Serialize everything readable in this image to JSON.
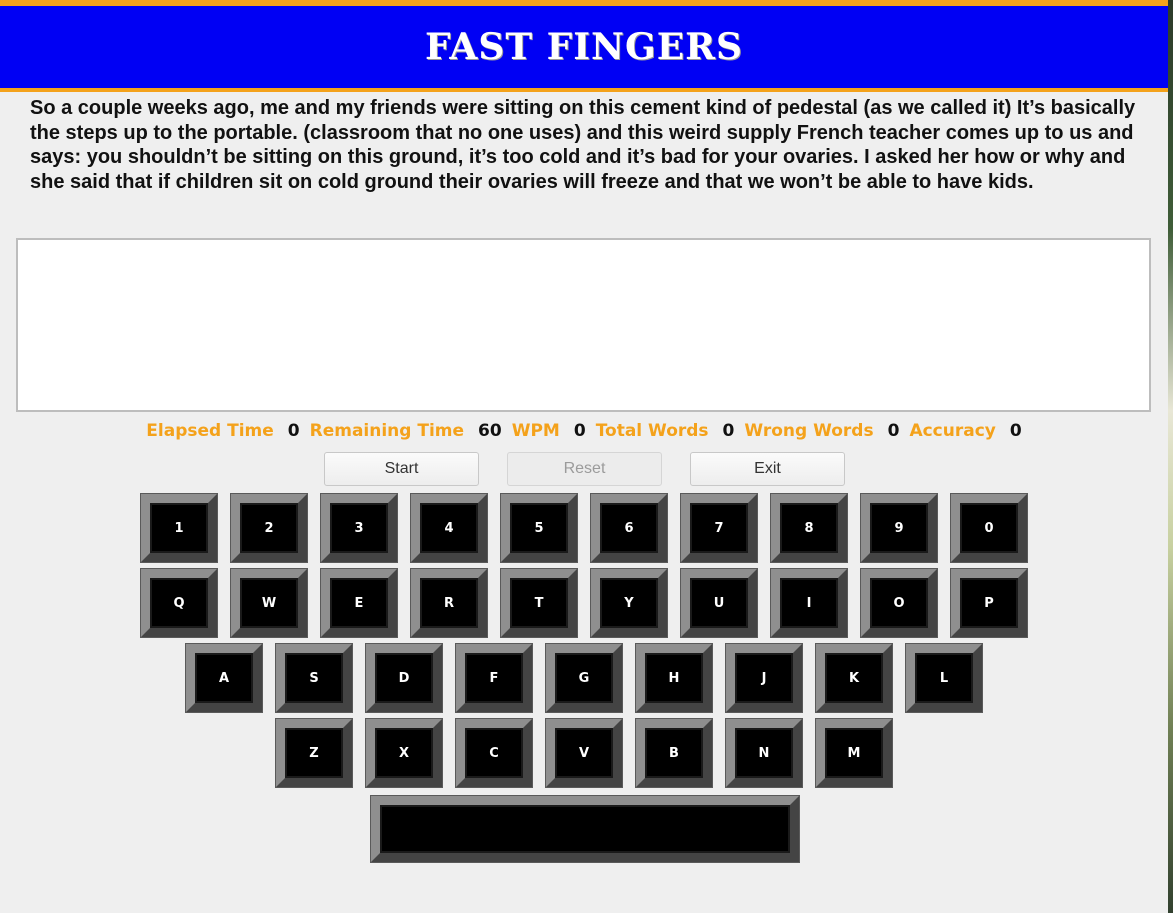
{
  "app": {
    "title": "FAST FINGERS"
  },
  "passage": {
    "text": "So a couple weeks ago, me and my friends were sitting on this cement kind of pedestal (as we called it) It’s basically the steps up to the portable. (classroom that no one uses) and this weird supply French teacher comes up to us and says: you shouldn’t be sitting on this ground, it’s too cold and it’s bad for your ovaries. I asked her how or why and she said that if children sit on cold ground their ovaries will freeze and that we won’t be able to have kids."
  },
  "input": {
    "value": ""
  },
  "stats": {
    "elapsed_label": "Elapsed Time",
    "elapsed_value": "0",
    "remaining_label": "Remaining Time",
    "remaining_value": "60",
    "wpm_label": "WPM",
    "wpm_value": "0",
    "total_words_label": "Total Words",
    "total_words_value": "0",
    "wrong_words_label": "Wrong Words",
    "wrong_words_value": "0",
    "accuracy_label": "Accuracy",
    "accuracy_value": "0"
  },
  "buttons": {
    "start": "Start",
    "reset": "Reset",
    "exit": "Exit"
  },
  "keyboard": {
    "row_numbers": [
      "1",
      "2",
      "3",
      "4",
      "5",
      "6",
      "7",
      "8",
      "9",
      "0"
    ],
    "row_top": [
      "Q",
      "W",
      "E",
      "R",
      "T",
      "Y",
      "U",
      "I",
      "O",
      "P"
    ],
    "row_home": [
      "A",
      "S",
      "D",
      "F",
      "G",
      "H",
      "J",
      "K",
      "L"
    ],
    "row_bottom": [
      "Z",
      "X",
      "C",
      "V",
      "B",
      "N",
      "M"
    ]
  },
  "colors": {
    "header_bg": "#0000f4",
    "accent": "#f4a21b",
    "page_bg": "#efefef",
    "key_bg": "#000000"
  }
}
